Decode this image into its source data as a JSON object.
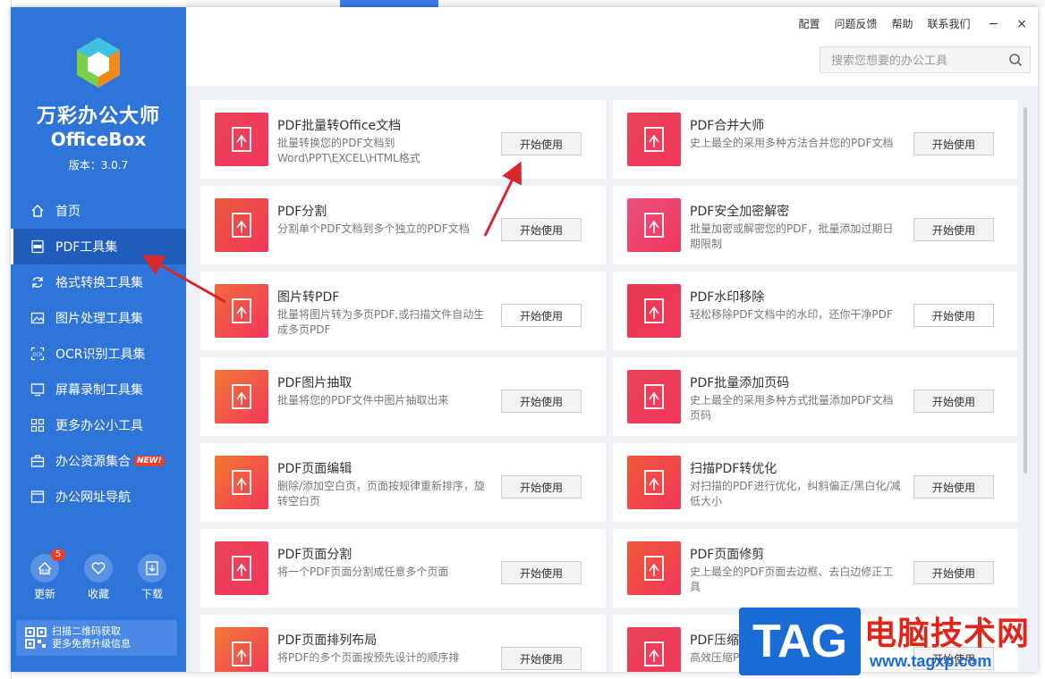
{
  "app": {
    "name_cn": "万彩办公大师",
    "name_en": "OfficeBox",
    "version_label": "版本：",
    "version": "3.0.7"
  },
  "sidebar": {
    "items": [
      {
        "label": "首页",
        "icon": "home-icon"
      },
      {
        "label": "PDF工具集",
        "icon": "pdf-icon",
        "active": true
      },
      {
        "label": "格式转换工具集",
        "icon": "refresh-icon"
      },
      {
        "label": "图片处理工具集",
        "icon": "image-icon"
      },
      {
        "label": "OCR识别工具集",
        "icon": "ocr-icon"
      },
      {
        "label": "屏幕录制工具集",
        "icon": "monitor-icon"
      },
      {
        "label": "更多办公小工具",
        "icon": "apps-icon"
      },
      {
        "label": "办公资源集合",
        "icon": "briefcase-icon",
        "badge": "NEW!"
      },
      {
        "label": "办公网址导航",
        "icon": "browser-icon"
      }
    ],
    "actions": [
      {
        "label": "更新",
        "badge": "5",
        "icon": "update-icon"
      },
      {
        "label": "收藏",
        "icon": "heart-icon"
      },
      {
        "label": "下载",
        "icon": "download-icon"
      }
    ],
    "qr": {
      "line1": "扫描二维码获取",
      "line2": "更多免费升级信息"
    }
  },
  "topbar": {
    "menu": [
      "配置",
      "问题反馈",
      "帮助",
      "联系我们"
    ],
    "minimize": "−",
    "close": "×",
    "search_placeholder": "搜索您想要的办公工具"
  },
  "tools": [
    {
      "title": "PDF批量转Office文档",
      "desc": "批量转换您的PDF文档到Word\\PPT\\EXCEL\\HTML格式",
      "button": "开始使用",
      "color": "#e8445a",
      "icon": "word-pdf-icon"
    },
    {
      "title": "PDF合并大师",
      "desc": "史上最全的采用多种方法合并您的PDF文档",
      "button": "开始使用",
      "color": "#e8445a",
      "icon": "merge-icon"
    },
    {
      "title": "PDF分割",
      "desc": "分割单个PDF文档到多个独立的PDF文档",
      "button": "开始使用",
      "color": "#ea5a3e",
      "icon": "split-icon"
    },
    {
      "title": "PDF安全加密解密",
      "desc": "批量加密或解密您的PDF，批量添加过期日期限制",
      "button": "开始使用",
      "color": "#e9527e",
      "icon": "lock-icon"
    },
    {
      "title": "图片转PDF",
      "desc": "批量将图片转为多页PDF,或扫描文件自动生成多页PDF",
      "button": "开始使用",
      "color": "#ef6a3c",
      "icon": "image-to-pdf-icon",
      "highlight": true
    },
    {
      "title": "PDF水印移除",
      "desc": "轻松移除PDF文档中的水印，还你干净PDF",
      "button": "开始使用",
      "color": "#e63a4f",
      "icon": "watermark-icon",
      "highlight": true
    },
    {
      "title": "PDF图片抽取",
      "desc": "批量将您的PDF文件中图片抽取出来",
      "button": "开始使用",
      "color": "#f07a35",
      "icon": "extract-image-icon"
    },
    {
      "title": "PDF批量添加页码",
      "desc": "史上最全的采用多种方式批量添加PDF文档页码",
      "button": "开始使用",
      "color": "#e8445a",
      "icon": "page-number-icon"
    },
    {
      "title": "PDF页面编辑",
      "desc": "删除/添加空白页，页面按规律重新排序，旋转空白页",
      "button": "开始使用",
      "color": "#f0782e",
      "icon": "edit-page-icon"
    },
    {
      "title": "扫描PDF转优化",
      "desc": "对扫描的PDF进行优化，纠斜偏正/黑白化/减低大小",
      "button": "开始使用",
      "color": "#ef5a3a",
      "icon": "scan-icon"
    },
    {
      "title": "PDF页面分割",
      "desc": "将一个PDF页面分割成任意多个页面",
      "button": "开始使用",
      "color": "#e8445a",
      "icon": "page-split-icon"
    },
    {
      "title": "PDF页面修剪",
      "desc": "史上最全的PDF页面去边框、去白边修正工具",
      "button": "开始使用",
      "color": "#ef5a3a",
      "icon": "crop-icon"
    },
    {
      "title": "PDF页面排列布局",
      "desc": "将PDF的多个页面按预先设计的顺序排",
      "button": "开始使用",
      "color": "#f07a35",
      "icon": "layout-icon"
    },
    {
      "title": "PDF压缩",
      "desc": "高效压缩PDF",
      "button": "开始使用",
      "color": "#e8445a",
      "icon": "compress-icon"
    }
  ],
  "watermark": {
    "tag": "TAG",
    "title": "电脑技术网",
    "url": "www.tagxp.com"
  },
  "colors": {
    "sidebar": "#2f74d8",
    "active": "#1f5cbc",
    "arrow": "#d8282e"
  }
}
